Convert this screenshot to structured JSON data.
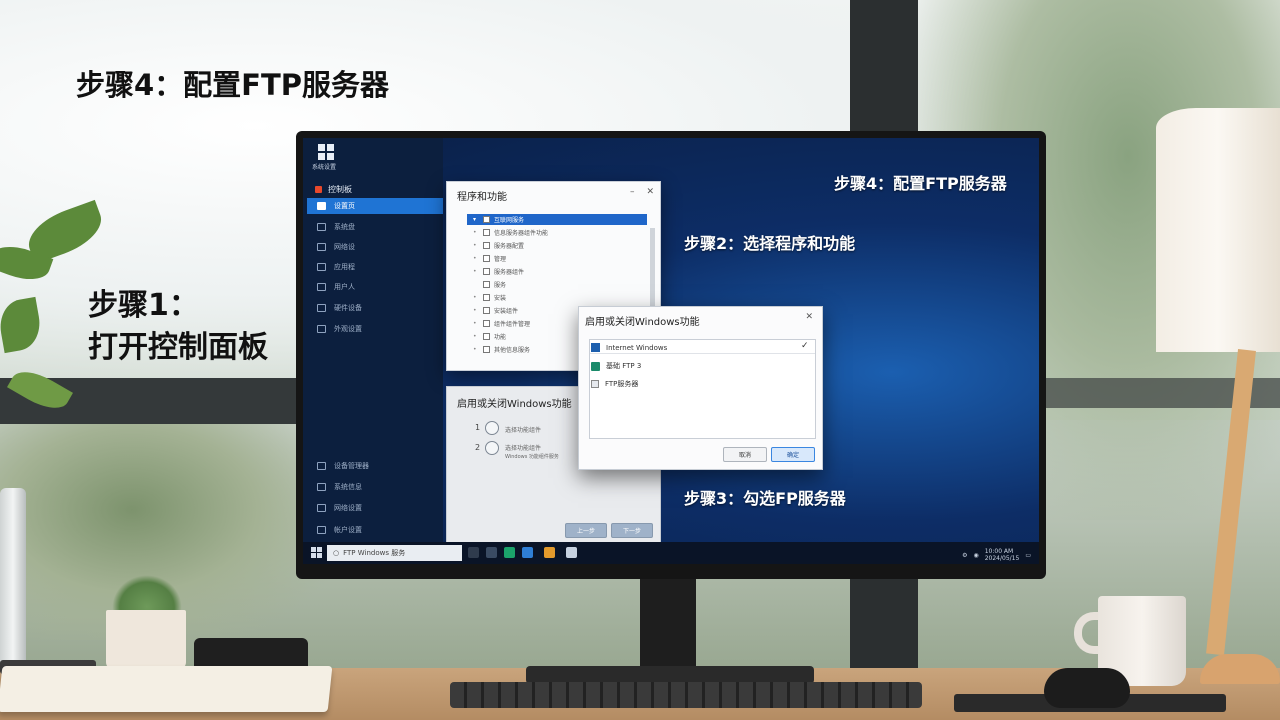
{
  "headings": {
    "step4_outside": "步骤4：配置FTP服务器",
    "step1_line1": "步骤1：",
    "step1_line2": "打开控制面板"
  },
  "screen_labels": {
    "step4": "步骤4：配置FTP服务器",
    "step2": "步骤2：选择程序和功能",
    "step3": "步骤3：勾选FP服务器"
  },
  "sidebar": {
    "logo_text": "系统设置",
    "header": "控制板",
    "items": [
      {
        "label": "设置页",
        "active": true,
        "icon": "home-icon"
      },
      {
        "label": "系统盘",
        "icon": "system-icon"
      },
      {
        "label": "网络设",
        "icon": "network-icon"
      },
      {
        "label": "应用程",
        "icon": "apps-icon"
      },
      {
        "label": "用户人",
        "icon": "user-icon"
      },
      {
        "label": "硬件设备",
        "icon": "hardware-icon"
      },
      {
        "label": "外观设置",
        "icon": "appearance-icon"
      }
    ],
    "bottom_items": [
      {
        "label": "设备管理器",
        "icon": "device-icon"
      },
      {
        "label": "系统信息",
        "icon": "info-icon"
      },
      {
        "label": "网络设置",
        "icon": "wifi-icon"
      },
      {
        "label": "帐户设置",
        "icon": "account-icon"
      }
    ]
  },
  "programs_dialog": {
    "title": "程序和功能",
    "close": "✕",
    "minimize": "–",
    "selected_row": "互联网服务",
    "rows": [
      "信息服务器组件功能",
      "服务器配置",
      "管理",
      "服务器组件",
      "服务",
      "安装",
      "安装组件",
      "组件组件管理",
      "功能",
      "其他信息服务"
    ]
  },
  "steps_dialog": {
    "title": "启用或关闭Windows功能",
    "step1_num": "1",
    "step1_text": "选择功能组件",
    "step2_num": "2",
    "step2_text": "选择功能组件",
    "step2_sub": "Windows 功能组件服务",
    "btn_back": "上一步",
    "btn_next": "下一步"
  },
  "features_dialog": {
    "title": "启用或关闭Windows功能",
    "close": "✕",
    "row1": "Internet Windows",
    "row2": "基础 FTP 3",
    "row3": "FTP服务器",
    "btn_cancel": "取消",
    "btn_ok": "确定"
  },
  "taskbar": {
    "search_text": "FTP Windows 服务",
    "tray_time": "10:00 AM",
    "tray_date": "2024/05/15"
  },
  "colors": {
    "accent": "#1f74d4",
    "screen_bg": "#0d2d66",
    "heading": "#111111"
  }
}
